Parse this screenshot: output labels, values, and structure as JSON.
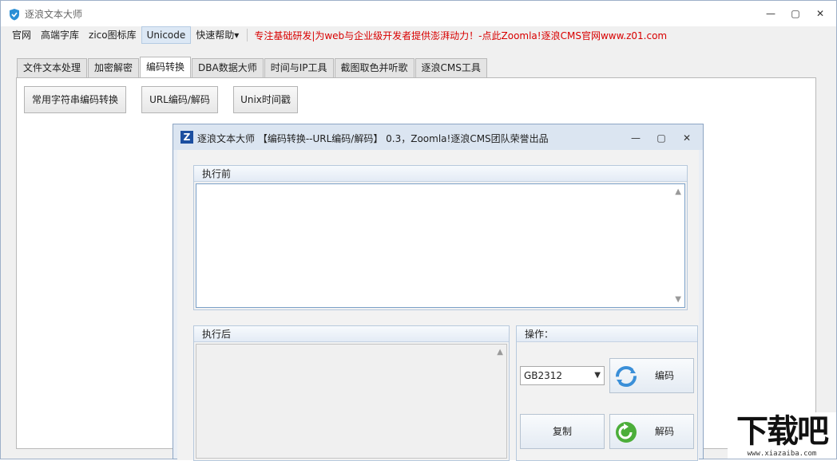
{
  "window": {
    "title": "逐浪文本大师",
    "controls": {
      "minimize": "—",
      "maximize": "▢",
      "close": "✕"
    }
  },
  "menubar": {
    "items": [
      "官网",
      "高端字库",
      "zico图标库",
      "Unicode",
      "快速帮助▾"
    ],
    "active_index": 3,
    "notice": "专注基础研发|为web与企业级开发者提供澎湃动力！-点此Zoomla!逐浪CMS官网www.z01.com"
  },
  "tabs": {
    "items": [
      "文件文本处理",
      "加密解密",
      "编码转换",
      "DBA数据大师",
      "时间与IP工具",
      "截图取色并听歌",
      "逐浪CMS工具"
    ],
    "selected_index": 2
  },
  "toolbar": {
    "buttons": [
      "常用字符串编码转换",
      "URL编码/解码",
      "Unix时间戳"
    ]
  },
  "child_window": {
    "icon_letter": "Z",
    "title": "逐浪文本大师 【编码转换--URL编码/解码】 0.3，Zoomla!逐浪CMS团队荣誉出品",
    "controls": {
      "minimize": "—",
      "maximize": "▢",
      "close": "✕"
    },
    "before_group": {
      "label": "执行前",
      "value": ""
    },
    "after_group": {
      "label": "执行后",
      "value": ""
    },
    "ops_group": {
      "label": "操作：",
      "encoding_select": "GB2312",
      "encode_label": "编码",
      "decode_label": "解码",
      "copy_label": "复制"
    }
  },
  "watermark": {
    "main": "下载吧",
    "sub": "www.xiazaiba.com"
  },
  "colors": {
    "accent": "#1c4fa0",
    "notice": "#d80000",
    "select_border": "#7aa0c8"
  }
}
